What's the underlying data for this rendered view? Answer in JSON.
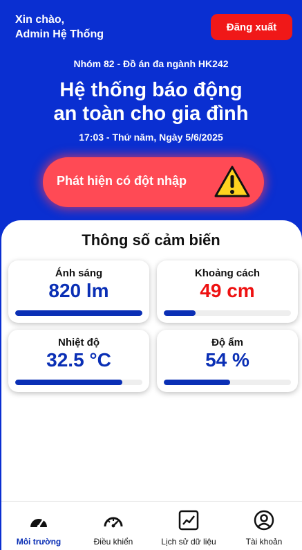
{
  "greeting": {
    "line1": "Xin chào,",
    "line2": "Admin Hệ Thống"
  },
  "logout_label": "Đăng xuất",
  "group_label": "Nhóm 82 - Đồ án đa ngành HK242",
  "title": {
    "line1": "Hệ thống báo động",
    "line2": "an toàn cho gia đình"
  },
  "datetime": "17:03 - Thứ năm, Ngày 5/6/2025",
  "alert": {
    "text": "Phát hiện có đột nhập",
    "icon": "warning-icon"
  },
  "sensors": {
    "title": "Thông số cảm biến",
    "light": {
      "label": "Ánh sáng",
      "value": "820 lm",
      "level": 1.0
    },
    "distance": {
      "label": "Khoảng cách",
      "value": "49 cm",
      "level": 0.25
    },
    "temperature": {
      "label": "Nhiệt độ",
      "value": "32.5 °C",
      "level": 0.84
    },
    "humidity": {
      "label": "Độ ẩm",
      "value": "54 %",
      "level": 0.52
    }
  },
  "colors": {
    "primary": "#0a2fd1",
    "alert": "#ff4a55",
    "danger": "#ee1111",
    "value": "#0a2fb5"
  },
  "nav": [
    {
      "label": "Môi trường",
      "icon": "gauge-icon",
      "active": true
    },
    {
      "label": "Điều khiển",
      "icon": "speedometer-icon",
      "active": false
    },
    {
      "label": "Lịch sử dữ liệu",
      "icon": "chart-line-icon",
      "active": false
    },
    {
      "label": "Tài khoản",
      "icon": "user-circle-icon",
      "active": false
    }
  ]
}
